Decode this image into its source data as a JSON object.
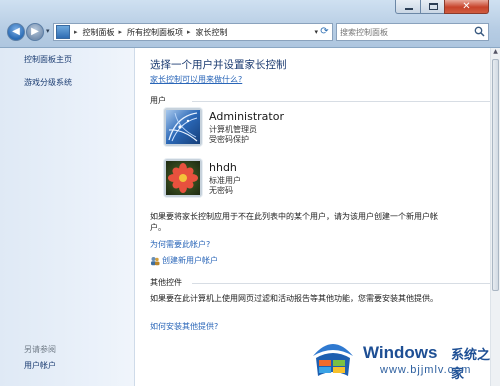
{
  "window": {
    "close_glyph": "✕"
  },
  "address": {
    "crumbs": [
      "控制面板",
      "所有控制面板项",
      "家长控制"
    ]
  },
  "search": {
    "placeholder": "搜索控制面板"
  },
  "sidebar": {
    "home": "控制面板主页",
    "rating": "游戏分级系统",
    "see_also": "另请参阅",
    "accounts": "用户帐户"
  },
  "main": {
    "title": "选择一个用户并设置家长控制",
    "help_link": "家长控制可以用来做什么?",
    "users_section": "用户",
    "users": [
      {
        "name": "Administrator",
        "role": "计算机管理员",
        "password": "受密码保护",
        "icon": "network-tile-avatar"
      },
      {
        "name": "hhdh",
        "role": "标准用户",
        "password": "无密码",
        "icon": "flower-avatar"
      }
    ],
    "para_1": "如果要将家长控制应用于不在此列表中的某个用户，请为该用户创建一个新用户帐户。",
    "why_link": "为何需要此帐户?",
    "create_link": "创建新用户帐户",
    "other_section": "其他控件",
    "para_2": "如果要在此计算机上使用网页过滤和活动报告等其他功能，您需要安装其他提供。",
    "install_link": "如何安装其他提供?"
  },
  "watermark": {
    "brand": "Windows",
    "cn": "系统之家",
    "url": "www.bjjmlv.com"
  },
  "colors": {
    "link": "#2a66b8",
    "title": "#1a3a70",
    "brand": "#1e4f94"
  }
}
